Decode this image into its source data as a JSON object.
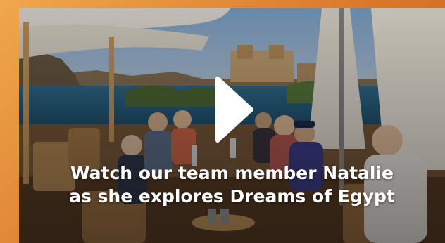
{
  "video": {
    "caption_line1": "Watch our team member Natalie",
    "caption_line2": "as she explores Dreams of Egypt",
    "play_icon": "play-icon"
  },
  "colors": {
    "background_orange": "#e08a35",
    "caption_text": "#ffffff",
    "play_button": "#ffffff"
  }
}
